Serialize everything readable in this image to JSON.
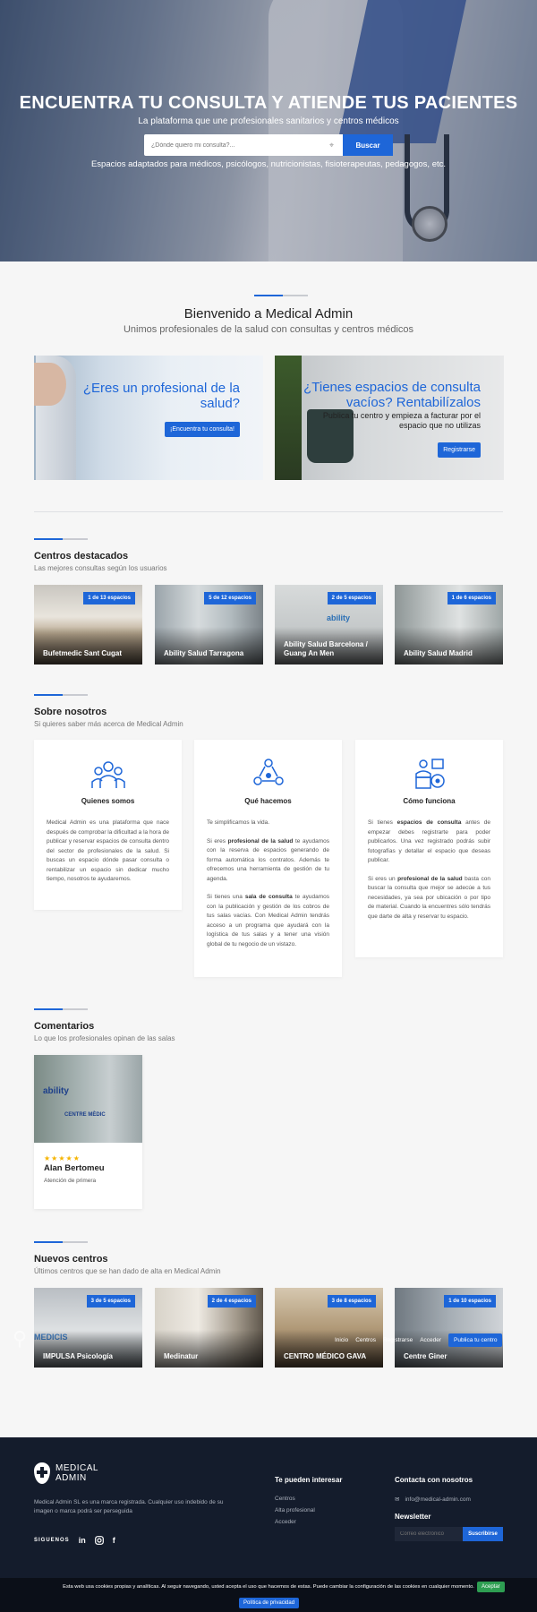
{
  "hero": {
    "title": "ENCUENTRA TU CONSULTA Y ATIENDE TUS PACIENTES",
    "subtitle": "La plataforma que une profesionales sanitarios y centros médicos",
    "search_placeholder": "¿Dónde quiero mi consulta?...",
    "search_button": "Buscar",
    "spaces_text": "Espacios adaptados para médicos, psicólogos, nutricionistas, fisioterapeutas, pedagogos, etc."
  },
  "welcome": {
    "title": "Bienvenido a Medical Admin",
    "subtitle": "Unimos profesionales de la salud con consultas y centros médicos"
  },
  "promo": {
    "left_title": "¿Eres un profesional de la salud?",
    "left_button": "¡Encuentra tu consulta!",
    "right_title": "¿Tienes espacios de consulta vacíos? Rentabilízalos",
    "right_text": "Publica tu centro y empieza a facturar por el espacio que no utilizas",
    "right_button": "Registrarse"
  },
  "featured": {
    "title": "Centros destacados",
    "subtitle": "Las mejores consultas según los usuarios",
    "cards": [
      {
        "badge": "1 de 13 espacios",
        "name": "Bufetmedic Sant Cugat"
      },
      {
        "badge": "5 de 12 espacios",
        "name": "Ability Salud Tarragona"
      },
      {
        "badge": "2 de 5 espacios",
        "name": "Ability Salud Barcelona / Guang An Men"
      },
      {
        "badge": "1 de 6 espacios",
        "name": "Ability Salud Madrid"
      }
    ]
  },
  "about": {
    "title": "Sobre nosotros",
    "subtitle": "Si quieres saber más acerca de Medical Admin",
    "col1_title": "Quienes somos",
    "col1_p1": "Medical Admin es una plataforma que nace después de comprobar la dificultad a la hora de publicar y reservar espacios de consulta dentro del sector de profesionales de la salud. Si buscas un espacio dónde pasar consulta o rentabilizar un espacio sin dedicar mucho tiempo, nosotros te ayudaremos.",
    "col2_title": "Qué hacemos",
    "col2_p1": "Te simplificamos la vida.",
    "col2_p2a": "Si eres ",
    "col2_p2b": "profesional de la salud",
    "col2_p2c": " te ayudamos con la reserva de espacios generando de forma automática los contratos. Además te ofrecemos una herramienta de gestión de tu agenda.",
    "col2_p3a": "Si tienes una ",
    "col2_p3b": "sala de consulta",
    "col2_p3c": " te ayudamos con la publicación y gestión de los cobros de tus salas vacías. Con Medical Admin tendrás acceso a un programa que ayudará con la logística de tus salas y a tener una visión global de tu negocio de un vistazo.",
    "col3_title": "Cómo funciona",
    "col3_p1a": "Si tienes ",
    "col3_p1b": "espacios de consulta",
    "col3_p1c": " antes de empezar debes registrarte para poder publicarlos. Una vez registrado podrás subir fotografías y detallar el espacio que deseas publicar.",
    "col3_p2a": "Si eres un ",
    "col3_p2b": "profesional de la salud",
    "col3_p2c": " basta con buscar la consulta que mejor se adecúe a tus necesidades, ya sea por ubicación o por tipo de material. Cuando la encuentres sólo tendrás que darte de alta y reservar tu espacio."
  },
  "comments": {
    "title": "Comentarios",
    "subtitle": "Lo que los profesionales opinan de las salas",
    "stars": "★★★★★",
    "name": "Alan Bertomeu",
    "role": "Atención de primera",
    "image_text1": "ability",
    "image_text2": "CENTRE MÈDIC"
  },
  "new_centers": {
    "title": "Nuevos centros",
    "subtitle": "Últimos centros que se han dado de alta en Medical Admin",
    "cards": [
      {
        "badge": "3 de 5 espacios",
        "name": "IMPULSA Psicología"
      },
      {
        "badge": "2 de 4 espacios",
        "name": "Medinatur"
      },
      {
        "badge": "3 de 8 espacios",
        "name": "CENTRO MÉDICO GAVA"
      },
      {
        "badge": "1 de 10 espacios",
        "name": "Centre Giner"
      }
    ]
  },
  "overlay_nav": {
    "items": [
      "Inicio",
      "Centros",
      "Registrarse",
      "Acceder"
    ],
    "publish": "Publica tu centro"
  },
  "footer": {
    "logo_line1": "MEDICAL",
    "logo_line2": "ADMIN",
    "text": "Medical Admin SL es una marca registrada. Cualquier uso indebido de su imagen o marca podrá ser perseguida",
    "follow": "SIGUENOS",
    "social": [
      "in",
      "f"
    ],
    "col2_title": "Te pueden interesar",
    "col2_links": [
      "Centros",
      "Alta profesional",
      "Acceder"
    ],
    "col3_title": "Contacta con nosotros",
    "email": "info@medical-admin.com",
    "newsletter_title": "Newsletter",
    "newsletter_placeholder": "Correo electrónico",
    "newsletter_button": "Suscribirse"
  },
  "cookie": {
    "text": "Esta web usa cookies propias y analíticas. Al seguir navegando, usted acepta el uso que hacemos de estas. Puede cambiar la configuración de las cookies en cualquier momento.",
    "accept": "Aceptar",
    "policy": "Política de privacidad"
  },
  "colors": {
    "accent": "#1e66d8",
    "footer_bg": "#141c2c",
    "stars": "#f5b400"
  }
}
